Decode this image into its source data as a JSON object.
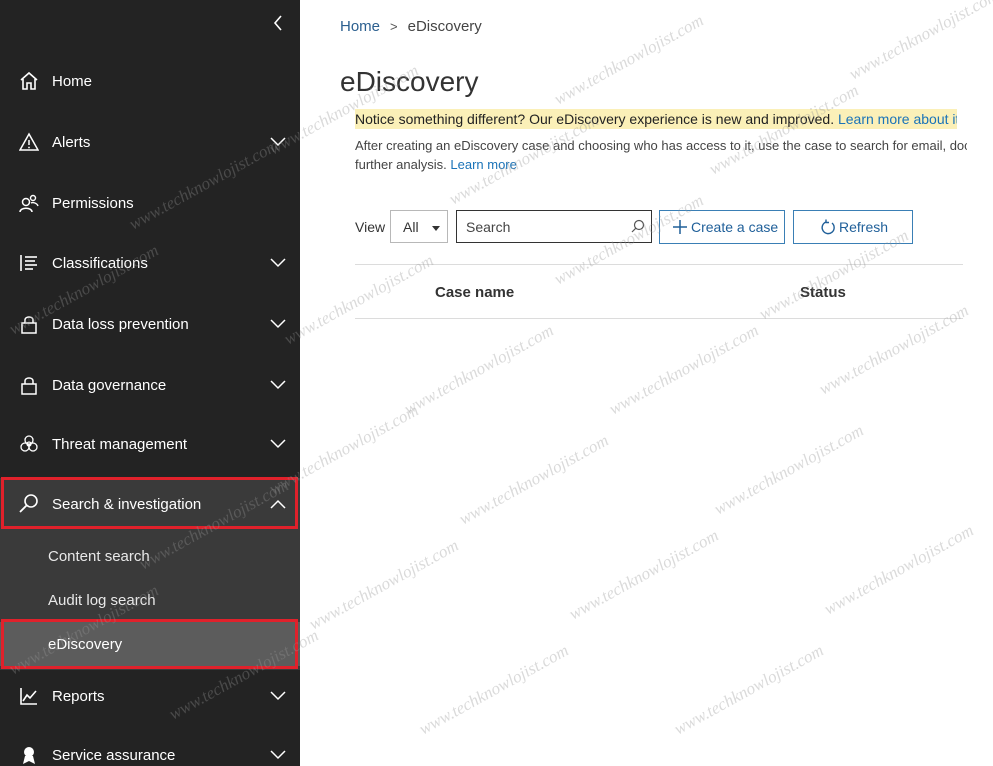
{
  "sidebar": {
    "items": [
      {
        "label": "Home",
        "icon": "home-icon",
        "expandable": false
      },
      {
        "label": "Alerts",
        "icon": "alert-icon",
        "expandable": true
      },
      {
        "label": "Permissions",
        "icon": "permissions-icon",
        "expandable": false
      },
      {
        "label": "Classifications",
        "icon": "list-icon",
        "expandable": true
      },
      {
        "label": "Data loss prevention",
        "icon": "lock-icon",
        "expandable": true
      },
      {
        "label": "Data governance",
        "icon": "lock-icon",
        "expandable": true
      },
      {
        "label": "Threat management",
        "icon": "biohazard-icon",
        "expandable": true
      },
      {
        "label": "Search & investigation",
        "icon": "search-icon",
        "expandable": true,
        "expanded": true
      },
      {
        "label": "Reports",
        "icon": "chart-icon",
        "expandable": true
      },
      {
        "label": "Service assurance",
        "icon": "ribbon-icon",
        "expandable": true
      }
    ],
    "sub_items": [
      {
        "label": "Content search"
      },
      {
        "label": "Audit log search"
      },
      {
        "label": "eDiscovery",
        "selected": true
      }
    ]
  },
  "breadcrumb": {
    "home": "Home",
    "separator": ">",
    "current": "eDiscovery"
  },
  "page": {
    "title": "eDiscovery",
    "notice_text": "Notice something different? Our eDiscovery experience is new and improved.",
    "notice_link": "Learn more about it",
    "description_line1": "After creating an eDiscovery case and choosing who has access to it, use the case to search for email, docu",
    "description_line2": "further analysis.",
    "description_link": "Learn more"
  },
  "toolbar": {
    "view_label": "View",
    "view_value": "All",
    "search_placeholder": "Search",
    "create_label": "Create a case",
    "refresh_label": "Refresh"
  },
  "table": {
    "columns": [
      "Case name",
      "Status"
    ]
  },
  "watermark": "www.techknowlojist.com",
  "colors": {
    "sidebar_bg": "#232323",
    "submenu_bg": "#3a3a3a",
    "selected_bg": "#5c5c5c",
    "highlight": "#e0212b",
    "link": "#1a73b8",
    "notice_bg": "#fbf0b8"
  }
}
